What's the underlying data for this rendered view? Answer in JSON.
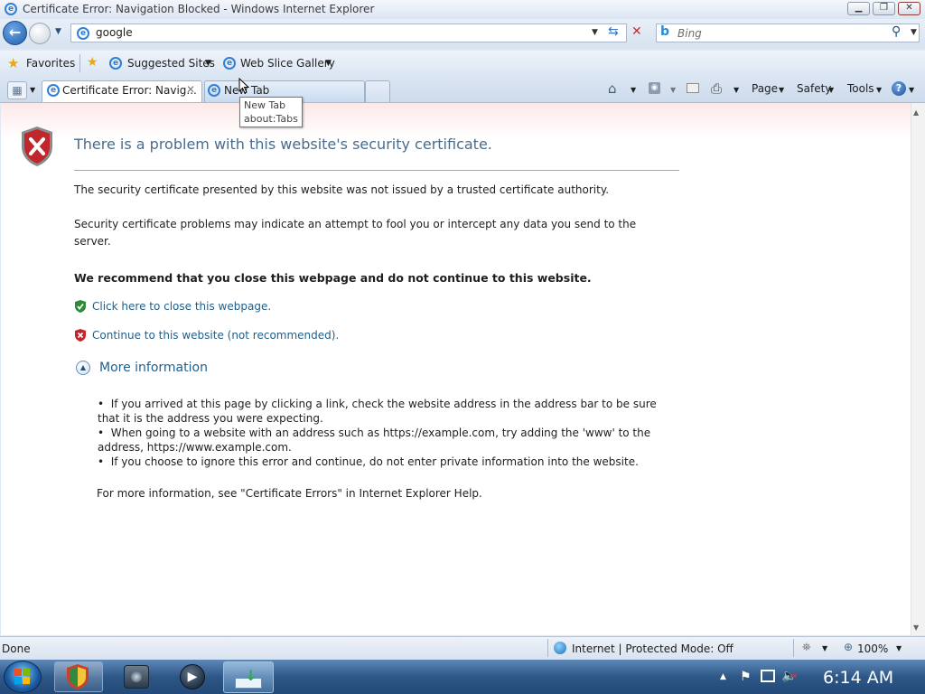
{
  "window": {
    "title": "Certificate Error: Navigation Blocked - Windows Internet Explorer"
  },
  "nav": {
    "address_value": "google",
    "search_placeholder": "Bing"
  },
  "favorites_bar": {
    "favorites_label": "Favorites",
    "suggested_sites_label": "Suggested Sites",
    "web_slice_gallery_label": "Web Slice Gallery"
  },
  "tabs": [
    {
      "label": "Certificate Error: Navig..."
    },
    {
      "label": "New Tab"
    }
  ],
  "tooltip": {
    "line1": "New Tab",
    "line2": "about:Tabs"
  },
  "command_bar": {
    "page_label": "Page",
    "safety_label": "Safety",
    "tools_label": "Tools"
  },
  "page": {
    "heading": "There is a problem with this website's security certificate.",
    "para1": "The security certificate presented by this website was not issued by a trusted certificate authority.",
    "para2_line1": "Security certificate problems may indicate an attempt to fool you or intercept any data you send to the",
    "para2_line2": "server.",
    "recommend": "We recommend that you close this webpage and do not continue to this website.",
    "close_link": "Click here to close this webpage.",
    "continue_link": "Continue to this website (not recommended).",
    "more_info": "More information",
    "bullet1_line1": "If you arrived at this page by clicking a link, check the website address in the address bar to be sure",
    "bullet1_line2": "that it is the address you were expecting.",
    "bullet2_line1": "When going to a website with an address such as https://example.com, try adding the 'www' to the",
    "bullet2_line2": "address, https://www.example.com.",
    "bullet3": "If you choose to ignore this error and continue, do not enter private information into the website.",
    "footer": "For more information, see \"Certificate Errors\" in Internet Explorer Help."
  },
  "status": {
    "left": "Done",
    "zone": "Internet | Protected Mode: Off",
    "zoom": "100%"
  },
  "taskbar": {
    "clock": "6:14 AM"
  },
  "colors": {
    "link": "#1f5f8b",
    "heading": "#4a6b8a",
    "shield_red": "#c0262b",
    "shield_green": "#2e8b3a"
  }
}
